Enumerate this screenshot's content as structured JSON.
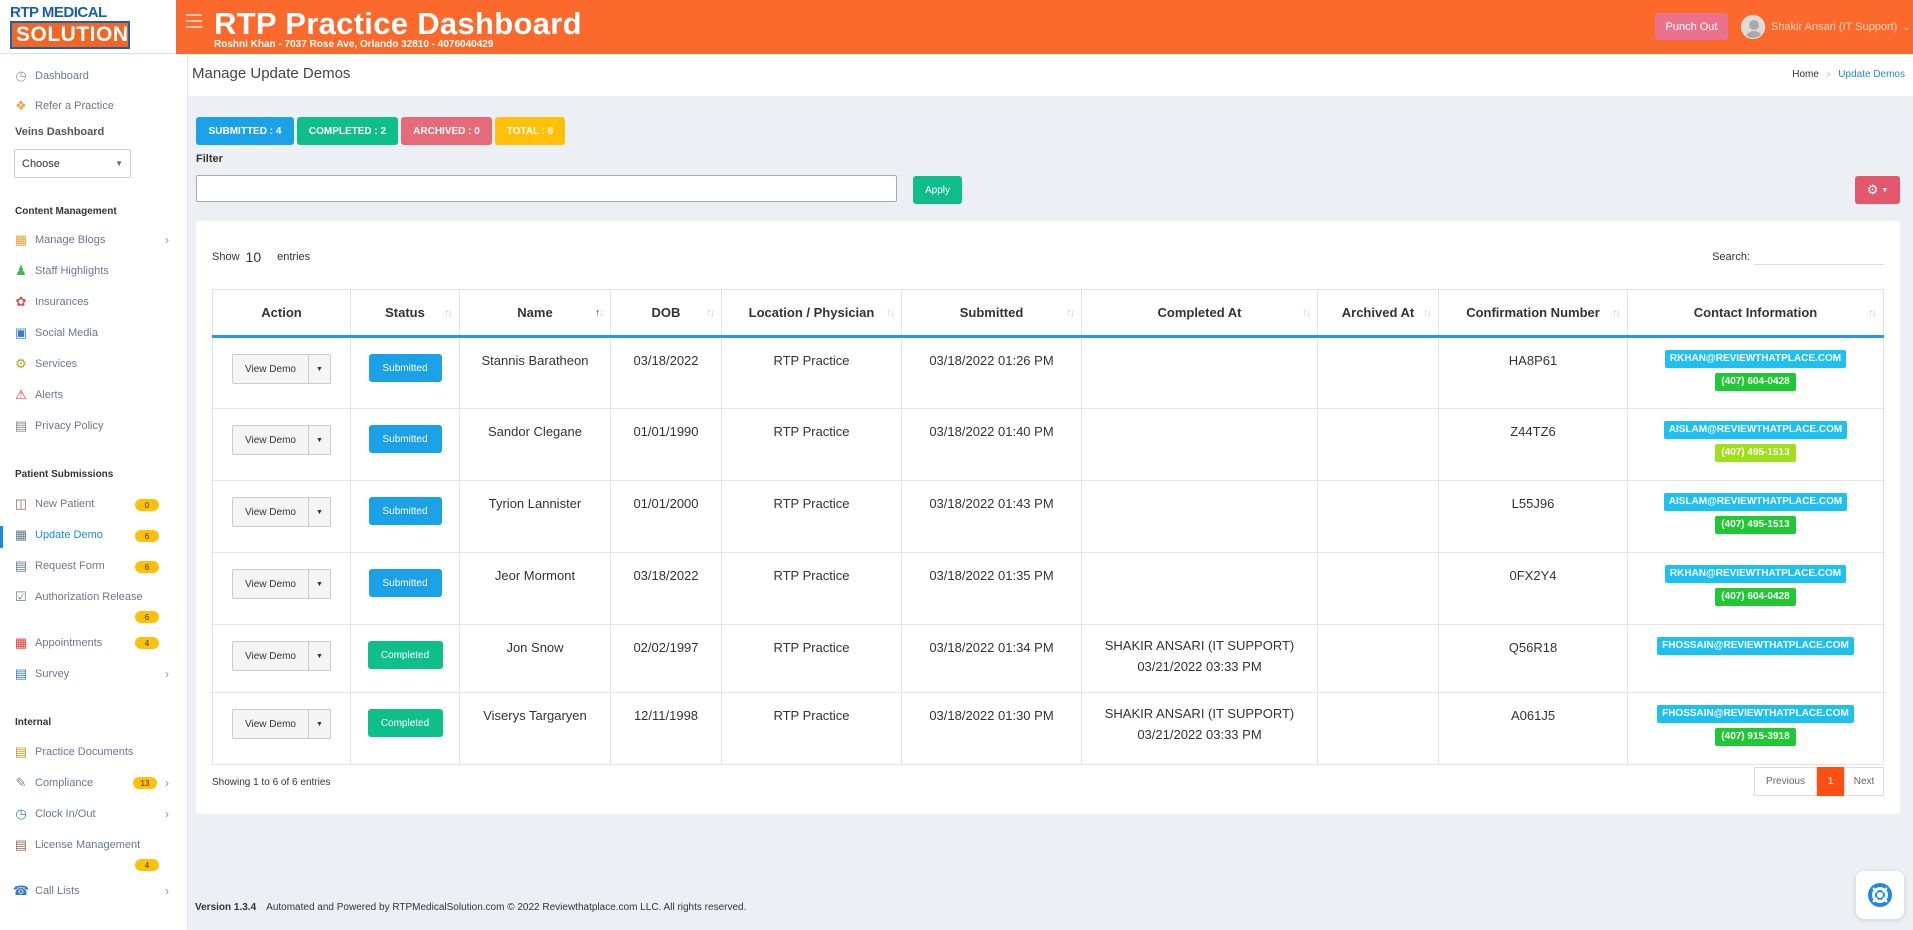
{
  "header": {
    "logo_line1": "RTP MEDICAL",
    "logo_line2": "SOLUTION",
    "title": "RTP Practice Dashboard",
    "subtitle": "Roshni Khan - 7037 Rose Ave, Orlando 32810 - 4076040429",
    "punch_out": "Punch Out",
    "user": "Shakir Ansari (IT Support)"
  },
  "sidebar": {
    "dashboard": "Dashboard",
    "refer": "Refer a Practice",
    "veins_heading": "Veins Dashboard",
    "veins_select": "Choose",
    "content_heading": "Content Management",
    "manage_blogs": "Manage Blogs",
    "staff_highlights": "Staff Highlights",
    "insurances": "Insurances",
    "social_media": "Social Media",
    "services": "Services",
    "alerts": "Alerts",
    "privacy_policy": "Privacy Policy",
    "patient_heading": "Patient Submissions",
    "new_patient": "New Patient",
    "new_patient_badge": "0",
    "update_demo": "Update Demo",
    "update_demo_badge": "6",
    "request_form": "Request Form",
    "request_form_badge": "6",
    "auth_release": "Authorization Release",
    "auth_release_badge": "6",
    "appointments": "Appointments",
    "appointments_badge": "4",
    "survey": "Survey",
    "internal_heading": "Internal",
    "practice_docs": "Practice Documents",
    "compliance": "Compliance",
    "compliance_badge": "13",
    "clock": "Clock In/Out",
    "license": "License Management",
    "license_badge": "4",
    "call_lists": "Call Lists"
  },
  "page": {
    "title": "Manage Update Demos",
    "crumb_home": "Home",
    "crumb_current": "Update Demos"
  },
  "pills": {
    "submitted": "SUBMITTED : 4",
    "completed": "COMPLETED : 2",
    "archived": "ARCHIVED : 0",
    "total": "TOTAL : 6"
  },
  "filter": {
    "label": "Filter",
    "value": "",
    "apply": "Apply"
  },
  "table": {
    "show_label": "Show",
    "show_count": "10",
    "entries_label": "entries",
    "search_label": "Search:",
    "columns": [
      "Action",
      "Status",
      "Name",
      "DOB",
      "Location / Physician",
      "Submitted",
      "Completed At",
      "Archived At",
      "Confirmation Number",
      "Contact Information"
    ],
    "view_label": "View Demo",
    "rows": [
      {
        "status": "Submitted",
        "name": "Stannis Baratheon",
        "dob": "03/18/2022",
        "location": "RTP Practice",
        "submitted": "03/18/2022 01:26 PM",
        "completed_by": "",
        "completed_at": "",
        "archived": "",
        "conf": "HA8P61",
        "email": "RKHAN@REVIEWTHATPLACE.COM",
        "phone": "(407) 604-0428"
      },
      {
        "status": "Submitted",
        "name": "Sandor Clegane",
        "dob": "01/01/1990",
        "location": "RTP Practice",
        "submitted": "03/18/2022 01:40 PM",
        "completed_by": "",
        "completed_at": "",
        "archived": "",
        "conf": "Z44TZ6",
        "email": "AISLAM@REVIEWTHATPLACE.COM",
        "phone": "(407) 495-1513"
      },
      {
        "status": "Submitted",
        "name": "Tyrion Lannister",
        "dob": "01/01/2000",
        "location": "RTP Practice",
        "submitted": "03/18/2022 01:43 PM",
        "completed_by": "",
        "completed_at": "",
        "archived": "",
        "conf": "L55J96",
        "email": "AISLAM@REVIEWTHATPLACE.COM",
        "phone": "(407) 495-1513"
      },
      {
        "status": "Submitted",
        "name": "Jeor Mormont",
        "dob": "03/18/2022",
        "location": "RTP Practice",
        "submitted": "03/18/2022 01:35 PM",
        "completed_by": "",
        "completed_at": "",
        "archived": "",
        "conf": "0FX2Y4",
        "email": "RKHAN@REVIEWTHATPLACE.COM",
        "phone": "(407) 604-0428"
      },
      {
        "status": "Completed",
        "name": "Jon Snow",
        "dob": "02/02/1997",
        "location": "RTP Practice",
        "submitted": "03/18/2022 01:34 PM",
        "completed_by": "SHAKIR ANSARI (IT SUPPORT)",
        "completed_at": "03/21/2022 03:33 PM",
        "archived": "",
        "conf": "Q56R18",
        "email": "FHOSSAIN@REVIEWTHATPLACE.COM",
        "phone": ""
      },
      {
        "status": "Completed",
        "name": "Viserys Targaryen",
        "dob": "12/11/1998",
        "location": "RTP Practice",
        "submitted": "03/18/2022 01:30 PM",
        "completed_by": "SHAKIR ANSARI (IT SUPPORT)",
        "completed_at": "03/21/2022 03:33 PM",
        "archived": "",
        "conf": "A061J5",
        "email": "FHOSSAIN@REVIEWTHATPLACE.COM",
        "phone": "(407) 915-3918"
      }
    ],
    "showing": "Showing 1 to 6 of 6 entries",
    "prev": "Previous",
    "page": "1",
    "next": "Next"
  },
  "footer": {
    "version": "Version 1.3.4",
    "text": "Automated and Powered by RTPMedicalSolution.com © 2022 Reviewthatplace.com LLC. All rights reserved."
  },
  "colors": {
    "brand": "#fb6a2c",
    "submitted": "#1ba1e6",
    "completed": "#0ebf8a",
    "archived": "#e56b78",
    "total": "#ffc107",
    "phone_green": "#20c933",
    "phone_lime": "#9ee11a"
  }
}
